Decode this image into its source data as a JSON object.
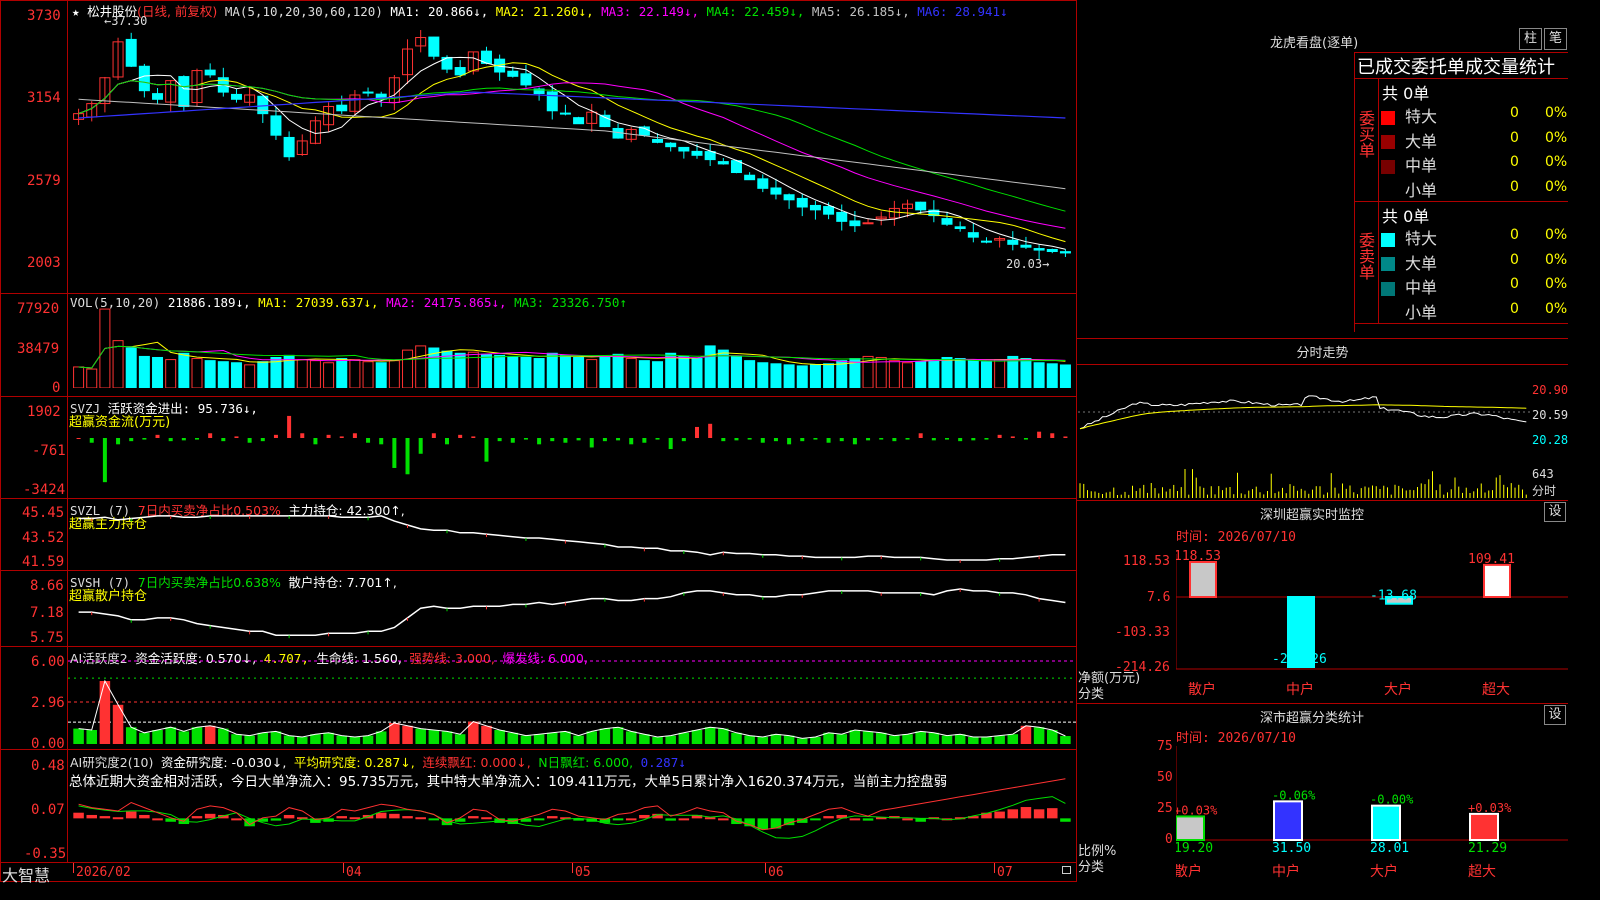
{
  "colors": {
    "up": "#ff3232",
    "down": "#00ffff",
    "green": "#00e000",
    "yellow": "#ffff00",
    "white": "#ffffff",
    "magenta": "#ff00ff",
    "blue": "#3333ff",
    "gray": "#c0c0c0",
    "axis_red": "#b00000"
  },
  "header": {
    "star": "★",
    "stock_name": "松井股份",
    "period": "(日线, 前复权)",
    "ma_spec": "MA(5,10,20,30,60,120)",
    "ma1": "MA1: 20.866↓,",
    "ma2": "MA2: 21.260↓,",
    "ma3": "MA3: 22.149↓,",
    "ma4": "MA4: 22.459↓,",
    "ma5": "MA5: 26.185↓,",
    "ma6": "MA6: 28.941↓"
  },
  "price_panel": {
    "y_ticks": [
      "3730",
      "3154",
      "2579",
      "2003"
    ],
    "high_label": "37.30",
    "low_label": "20.03"
  },
  "vol_panel": {
    "title": "VOL(5,10,20)",
    "value": "21886.189↓,",
    "ma1": "MA1: 27039.637↓,",
    "ma2": "MA2: 24175.865↓,",
    "ma3": "MA3: 23326.750↑",
    "y_ticks": [
      "77920",
      "38479",
      "0"
    ]
  },
  "svzj_panel": {
    "title": "SVZJ",
    "text": "活跃资金进出: 95.736↓,",
    "sub": "超赢资金流(万元)",
    "y_ticks": [
      "1902",
      "-761",
      "-3424"
    ]
  },
  "svzl_panel": {
    "title": "SVZL (7)",
    "t1": "7日内买卖净占比0.503%",
    "t2": "主力持仓: 42.300↑,",
    "sub": "超赢主力持仓",
    "y_ticks": [
      "45.45",
      "43.52",
      "41.59"
    ]
  },
  "svsh_panel": {
    "title": "SVSH (7)",
    "t1": "7日内买卖净占比0.638%",
    "t2": "散户持仓: 7.701↑,",
    "sub": "超赢散户持仓",
    "y_ticks": [
      "8.66",
      "7.18",
      "5.75"
    ]
  },
  "ai1_panel": {
    "title": "AI活跃度2",
    "t1": "资金活跃度: 0.570↓,",
    "t2": "4.707,",
    "t3": "生命线: 1.560,",
    "t4": "强势线: 3.000,",
    "t5": "爆发线: 6.000,",
    "y_ticks": [
      "6.00",
      "2.96",
      "0.00"
    ]
  },
  "ai2_panel": {
    "title": "AI研究度2(10)",
    "t1": "资金研究度: -0.030↓,",
    "t2": "平均研究度: 0.287↓,",
    "t3": "连续飘红: 0.000↓,",
    "t4": "N日飘红: 6.000,",
    "t5": "0.287↓",
    "summary": "总体近期大资金相对活跃，今日大单净流入：95.735万元，其中特大单净流入：109.411万元，大单5日累计净入1620.374万元，当前主力控盘弱",
    "y_ticks": [
      "0.48",
      "0.07",
      "-0.35"
    ]
  },
  "footer": {
    "brand": "大智慧",
    "dates": [
      "2026/02",
      "04",
      "05",
      "06",
      "07"
    ]
  },
  "dragon": {
    "title": "龙虎看盘(逐单)",
    "tab_bar": "柱",
    "tab_list": "笔",
    "subtitle": "已成交委托单成交量统计",
    "buy_label": "委买单",
    "sell_label": "委卖单",
    "buy_total": "共 0单",
    "sell_total": "共 0单",
    "rows": [
      {
        "name": "特大",
        "count": "0",
        "pct": "0%"
      },
      {
        "name": "大单",
        "count": "0",
        "pct": "0%"
      },
      {
        "name": "中单",
        "count": "0",
        "pct": "0%"
      },
      {
        "name": "小单",
        "count": "0",
        "pct": "0%"
      }
    ]
  },
  "intraday": {
    "title": "分时走势",
    "prices": [
      "20.90",
      "20.59",
      "20.28"
    ],
    "vol_label": "643",
    "vol_unit": "分时"
  },
  "monitor": {
    "title": "深圳超赢实时监控",
    "set": "设",
    "time": "时间: 2026/07/10",
    "y_ticks": [
      "118.53",
      "7.6",
      "-103.33",
      "-214.26"
    ],
    "y_label": "净额(万元)",
    "x_label": "分类",
    "categories": [
      "散户",
      "中户",
      "大户",
      "超大"
    ],
    "values_text": [
      "118.53",
      "-214.26",
      "-13.68",
      "109.41"
    ]
  },
  "classify": {
    "title": "深市超赢分类统计",
    "set": "设",
    "time": "时间: 2026/07/10",
    "y_ticks": [
      "75",
      "50",
      "25",
      "0"
    ],
    "y_label": "比例%",
    "x_label": "分类",
    "categories": [
      "散户",
      "中户",
      "大户",
      "超大"
    ],
    "changes": [
      "+0.03%",
      "-0.06%",
      "-0.00%",
      "+0.03%"
    ],
    "values_text": [
      "19.20",
      "31.50",
      "28.01",
      "21.29"
    ]
  },
  "chart_data": [
    {
      "type": "candlestick",
      "title": "松井股份 (日线, 前复权)",
      "ylim": [
        20.03,
        37.3
      ],
      "y_ticks": [
        37.3,
        31.54,
        25.79,
        20.03
      ],
      "approx_close_path": [
        30.5,
        31.2,
        33.0,
        35.5,
        33.8,
        32.1,
        31.5,
        32.8,
        31.0,
        33.5,
        33.2,
        32.0,
        31.5,
        31.8,
        30.5,
        29.0,
        27.5,
        28.6,
        30.0,
        31.0,
        30.7,
        31.8,
        32.0,
        31.5,
        33.0,
        35.0,
        35.8,
        34.5,
        33.6,
        33.2,
        34.8,
        34.0,
        33.4,
        33.1,
        32.5,
        31.9,
        30.7,
        30.5,
        29.8,
        30.6,
        29.6,
        28.8,
        29.4,
        29.0,
        28.5,
        28.2,
        27.9,
        27.6,
        27.3,
        27.0,
        26.4,
        25.9,
        25.3,
        24.9,
        24.5,
        24.0,
        23.8,
        23.5,
        23.0,
        22.7,
        22.9,
        23.3,
        23.9,
        24.2,
        23.8,
        23.4,
        22.8,
        22.5,
        21.9,
        21.6,
        21.8,
        21.4,
        21.2,
        21.0,
        20.9,
        20.8
      ],
      "ma_values": {
        "MA1": 20.866,
        "MA2": 21.26,
        "MA3": 22.149,
        "MA4": 22.459,
        "MA5": 26.185,
        "MA6": 28.941
      }
    },
    {
      "type": "bar",
      "title": "VOL(5,10,20)",
      "ylim": [
        0,
        77920
      ],
      "approx_values": [
        20000,
        18000,
        75000,
        45000,
        38000,
        30000,
        29000,
        27000,
        33000,
        28000,
        26000,
        25000,
        24000,
        22000,
        25000,
        29000,
        31000,
        27000,
        26000,
        24000,
        28000,
        27000,
        25000,
        24000,
        26000,
        36000,
        40000,
        38000,
        35000,
        33000,
        34000,
        32000,
        31000,
        30000,
        29000,
        28000,
        33000,
        31000,
        29000,
        27000,
        30000,
        32000,
        28000,
        26000,
        25000,
        33000,
        30000,
        28000,
        40000,
        36000,
        30000,
        26000,
        24000,
        23000,
        22000,
        21000,
        22000,
        23000,
        26000,
        28000,
        30000,
        29000,
        26000,
        24000,
        25000,
        27000,
        29000,
        28000,
        26000,
        25000,
        27000,
        30000,
        28000,
        24000,
        23000,
        21886
      ]
    },
    {
      "type": "bar",
      "title": "活跃资金进出 / 超赢资金流(万元)",
      "ylim": [
        -3424,
        1902
      ],
      "approx_values": [
        0,
        -300,
        -2800,
        -400,
        -200,
        -100,
        200,
        -200,
        -150,
        -100,
        300,
        -200,
        100,
        -300,
        -200,
        200,
        1400,
        300,
        -400,
        200,
        100,
        300,
        -300,
        -400,
        -1900,
        -2300,
        -1000,
        300,
        -400,
        200,
        100,
        -1500,
        -200,
        -300,
        -100,
        -400,
        -200,
        -300,
        -150,
        -600,
        -200,
        -150,
        -400,
        -300,
        -100,
        -700,
        -200,
        700,
        900,
        -200,
        -150,
        -100,
        -300,
        -200,
        -400,
        -200,
        -100,
        -300,
        -200,
        -400,
        -150,
        -100,
        -200,
        -100,
        300,
        -150,
        -100,
        -200,
        -150,
        -100,
        200,
        100,
        -100,
        400,
        300,
        96
      ]
    },
    {
      "type": "line",
      "title": "超赢主力持仓",
      "ylim": [
        41.59,
        45.45
      ],
      "approx_values": [
        45.1,
        45.1,
        45.2,
        45.0,
        45.1,
        45.2,
        45.3,
        45.3,
        45.2,
        45.2,
        45.3,
        45.3,
        45.3,
        45.3,
        45.3,
        45.3,
        45.3,
        45.3,
        45.3,
        45.3,
        45.2,
        45.2,
        45.2,
        45.3,
        44.9,
        44.6,
        44.3,
        44.2,
        44.2,
        44.0,
        44.0,
        43.9,
        43.8,
        43.7,
        43.6,
        43.6,
        43.5,
        43.4,
        43.3,
        43.2,
        43.1,
        42.9,
        42.9,
        42.8,
        42.8,
        42.6,
        42.6,
        42.5,
        42.3,
        42.5,
        42.4,
        42.4,
        42.3,
        42.3,
        42.2,
        42.2,
        42.1,
        42.1,
        42.1,
        42.1,
        42.2,
        42.2,
        42.1,
        42.1,
        42.1,
        42.0,
        41.9,
        41.9,
        41.9,
        41.9,
        42.0,
        42.0,
        42.1,
        42.2,
        42.3,
        42.3
      ]
    },
    {
      "type": "line",
      "title": "超赢散户持仓",
      "ylim": [
        5.75,
        8.66
      ],
      "approx_values": [
        7.2,
        7.2,
        7.1,
        7.0,
        6.8,
        6.8,
        6.9,
        6.9,
        6.8,
        6.6,
        6.5,
        6.4,
        6.3,
        6.2,
        6.2,
        6.0,
        6.0,
        6.0,
        6.0,
        6.1,
        6.1,
        6.1,
        6.2,
        6.2,
        6.4,
        6.9,
        7.4,
        7.5,
        7.4,
        7.4,
        7.5,
        7.5,
        7.5,
        7.6,
        7.6,
        7.7,
        7.6,
        7.7,
        7.8,
        7.9,
        7.9,
        7.8,
        7.8,
        7.9,
        7.9,
        8.0,
        8.2,
        8.3,
        8.3,
        8.2,
        8.1,
        8.1,
        8.0,
        8.0,
        8.1,
        8.1,
        8.2,
        8.3,
        8.3,
        8.3,
        8.3,
        8.2,
        8.2,
        8.2,
        8.2,
        8.1,
        8.3,
        8.4,
        8.3,
        8.3,
        8.2,
        8.2,
        8.1,
        7.9,
        7.8,
        7.7
      ]
    },
    {
      "type": "bar",
      "title": "AI活跃度2",
      "ylim": [
        0,
        6
      ],
      "approx_values": [
        1.1,
        1.0,
        4.5,
        2.8,
        1.2,
        0.8,
        1.0,
        1.2,
        0.9,
        1.2,
        1.3,
        1.1,
        0.7,
        0.6,
        0.8,
        0.9,
        0.6,
        0.5,
        0.7,
        0.8,
        0.6,
        0.5,
        0.6,
        0.9,
        1.5,
        1.3,
        1.1,
        1.0,
        0.9,
        0.7,
        1.6,
        1.3,
        1.0,
        0.8,
        0.6,
        0.7,
        0.8,
        0.9,
        0.6,
        0.9,
        1.1,
        1.2,
        0.9,
        0.7,
        0.5,
        0.6,
        0.8,
        1.0,
        1.2,
        1.1,
        0.8,
        0.6,
        0.5,
        0.7,
        0.6,
        0.4,
        0.5,
        0.8,
        0.7,
        1.0,
        0.9,
        0.8,
        0.6,
        0.7,
        0.9,
        0.8,
        0.6,
        0.7,
        0.5,
        0.5,
        0.6,
        0.7,
        1.3,
        1.2,
        1.0,
        0.57
      ],
      "lines": {
        "生命线": 1.56,
        "强势线": 3.0,
        "爆发线": 6.0
      }
    },
    {
      "type": "bar",
      "title": "AI研究度2(10)",
      "ylim": [
        -0.35,
        0.48
      ],
      "approx_values": [
        0.05,
        0.03,
        0.02,
        0.01,
        0.06,
        0.03,
        0.0,
        -0.03,
        -0.05,
        0.02,
        0.04,
        0.03,
        0.0,
        -0.07,
        -0.03,
        -0.02,
        0.03,
        0.01,
        -0.04,
        -0.03,
        0.02,
        0.01,
        0.03,
        0.05,
        0.04,
        0.02,
        0.01,
        -0.01,
        -0.06,
        -0.03,
        0.02,
        0.01,
        -0.04,
        -0.05,
        -0.03,
        -0.01,
        0.02,
        0.01,
        -0.02,
        -0.03,
        -0.04,
        -0.01,
        0.0,
        0.03,
        0.04,
        -0.02,
        0.0,
        0.03,
        0.01,
        0.0,
        -0.05,
        -0.07,
        -0.1,
        -0.09,
        -0.06,
        -0.04,
        -0.01,
        0.02,
        0.03,
        0.0,
        -0.02,
        0.01,
        0.02,
        0.0,
        -0.03,
        0.01,
        0.0,
        0.01,
        0.02,
        0.05,
        0.06,
        0.08,
        0.1,
        0.08,
        0.09,
        -0.03
      ]
    },
    {
      "type": "bar",
      "title": "深圳超赢实时监控",
      "categories": [
        "散户",
        "中户",
        "大户",
        "超大"
      ],
      "values": [
        118.53,
        -214.26,
        -13.68,
        109.41
      ],
      "ylim": [
        -214.26,
        118.53
      ]
    },
    {
      "type": "bar",
      "title": "深市超赢分类统计",
      "categories": [
        "散户",
        "中户",
        "大户",
        "超大"
      ],
      "values": [
        19.2,
        31.5,
        28.01,
        21.29
      ],
      "ylim": [
        0,
        75
      ]
    }
  ]
}
